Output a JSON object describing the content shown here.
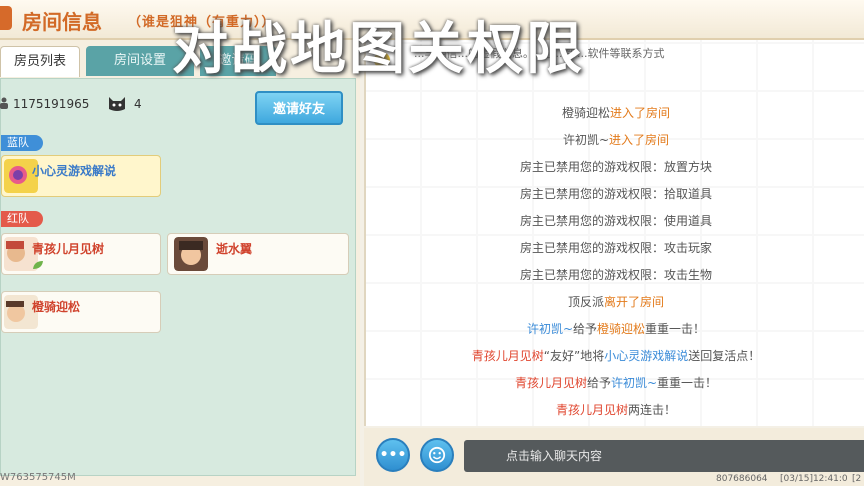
{
  "title": {
    "main": "房间信息",
    "sub": "（谁是狙神（有重力））"
  },
  "overlay_caption": "对战地图关权限",
  "tabs": {
    "members": "房员列表",
    "settings": "房间设置",
    "invite": "邀请码"
  },
  "room": {
    "id": "1175191965",
    "count": "4",
    "invite_button": "邀请好友"
  },
  "teams": {
    "blue": {
      "label": "蓝队",
      "players": [
        {
          "name": "小心灵游戏解说"
        }
      ]
    },
    "red": {
      "label": "红队",
      "players": [
        {
          "name": "青孩儿月见树"
        },
        {
          "name": "逝水翼"
        },
        {
          "name": "橙骑迎松"
        }
      ]
    }
  },
  "footer": {
    "left_id": "W763575745M",
    "right_id": "807686064",
    "right_time": "[03/15]12:41:0",
    "right_suffix": "[2"
  },
  "notice": "...与相信...的虚假消息。...止...等...软件等联系方式",
  "chat": [
    {
      "name": "橙骑迎松",
      "text": "进入了房间"
    },
    {
      "name": "许初凯~",
      "text": "进入了房间"
    },
    {
      "text": "房主已禁用您的游戏权限：放置方块"
    },
    {
      "text": "房主已禁用您的游戏权限：拾取道具"
    },
    {
      "text": "房主已禁用您的游戏权限：使用道具"
    },
    {
      "text": "房主已禁用您的游戏权限：攻击玩家"
    },
    {
      "text": "房主已禁用您的游戏权限：攻击生物"
    },
    {
      "name": "顶反派",
      "text": "离开了房间"
    },
    {
      "a": "许初凯~",
      "mid": "给予",
      "b": "橙骑迎松",
      "end": "重重一击！"
    },
    {
      "a": "青孩儿月见树",
      "mid": "“友好”地将",
      "b": "小心灵游戏解说",
      "end": "送回复活点！"
    },
    {
      "a": "青孩儿月见树",
      "mid": "给予",
      "b": "许初凯~",
      "end": "重重一击！"
    },
    {
      "a": "青孩儿月见树",
      "end": "两连击！"
    }
  ],
  "input": {
    "placeholder": "点击输入聊天内容"
  },
  "icons": {
    "more": "ellipsis-icon",
    "emoji": "smile-icon",
    "notice": "notice-icon",
    "cat": "cat-icon",
    "user": "user-icon",
    "leaf": "leaf-icon"
  }
}
